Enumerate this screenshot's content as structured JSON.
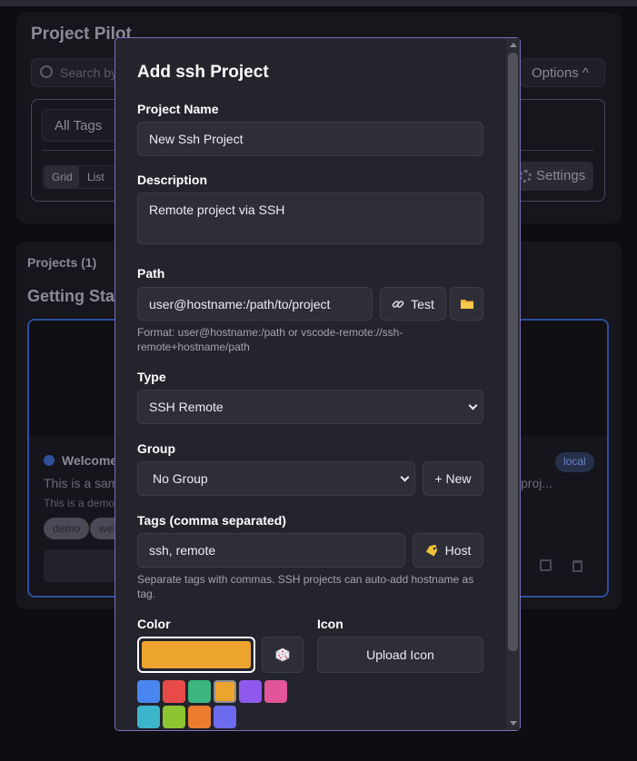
{
  "background": {
    "app_title": "Project Pilot",
    "search_placeholder": "Search by",
    "options_label": "Options ^",
    "all_tags_label": "All Tags",
    "view_grid_label": "Grid",
    "view_list_label": "List",
    "settings_label": "Settings",
    "projects_count_label": "Projects (1)",
    "group_heading": "Getting Star",
    "card": {
      "title": "Welcome",
      "badge": "local",
      "description": "This is a sam",
      "description_tail": "proj...",
      "sub_description": "This is a demo",
      "tags": [
        "demo",
        "wel"
      ]
    }
  },
  "modal": {
    "title": "Add ssh Project",
    "project_name": {
      "label": "Project Name",
      "value": "New Ssh Project"
    },
    "description": {
      "label": "Description",
      "value": "Remote project via SSH"
    },
    "path": {
      "label": "Path",
      "value": "user@hostname:/path/to/project",
      "test_label": "Test",
      "hint": "Format: user@hostname:/path or vscode-remote://ssh-remote+hostname/path"
    },
    "type": {
      "label": "Type",
      "selected": "SSH Remote"
    },
    "group": {
      "label": "Group",
      "selected": "No Group",
      "new_label": "+ New"
    },
    "tags": {
      "label": "Tags (comma separated)",
      "value": "ssh, remote",
      "host_label": "Host",
      "hint": "Separate tags with commas. SSH projects can auto-add hostname as tag."
    },
    "color": {
      "label": "Color",
      "value": "#eda42e",
      "selected_index": 3,
      "swatches": [
        "#4a86f0",
        "#e84a4a",
        "#3bb67e",
        "#eda42e",
        "#8f59ee",
        "#e2559a",
        "#3cb4c9",
        "#8cc432",
        "#ec7c2e",
        "#6c6aee"
      ]
    },
    "icon": {
      "label": "Icon",
      "upload_label": "Upload Icon"
    }
  }
}
